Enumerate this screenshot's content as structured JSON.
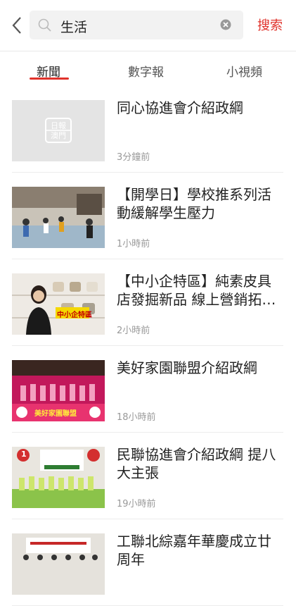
{
  "header": {
    "back_icon": "chevron-left-icon",
    "search_query": "生活",
    "search_button": "搜索",
    "accent_color": "#e0322b"
  },
  "tabs": [
    {
      "label": "新聞",
      "active": true
    },
    {
      "label": "數字報",
      "active": false
    },
    {
      "label": "小視頻",
      "active": false
    }
  ],
  "articles": [
    {
      "title": "同心協進會介紹政綱",
      "time": "3分鐘前",
      "thumb_text": "日報 澳門"
    },
    {
      "title": "【開學日】學校推系列活動緩解學生壓力",
      "time": "1小時前",
      "thumb_text": ""
    },
    {
      "title": "【中小企特區】純素皮具店發掘新品 線上營銷拓…",
      "time": "2小時前",
      "thumb_text": "中小企特區"
    },
    {
      "title": "美好家園聯盟介紹政綱",
      "time": "18小時前",
      "thumb_text": "美好家園聯盟"
    },
    {
      "title": "民聯協進會介紹政綱 提八大主張",
      "time": "19小時前",
      "thumb_text": "1"
    },
    {
      "title": "工聯北綜嘉年華慶成立廿周年",
      "time": "",
      "thumb_text": ""
    }
  ]
}
